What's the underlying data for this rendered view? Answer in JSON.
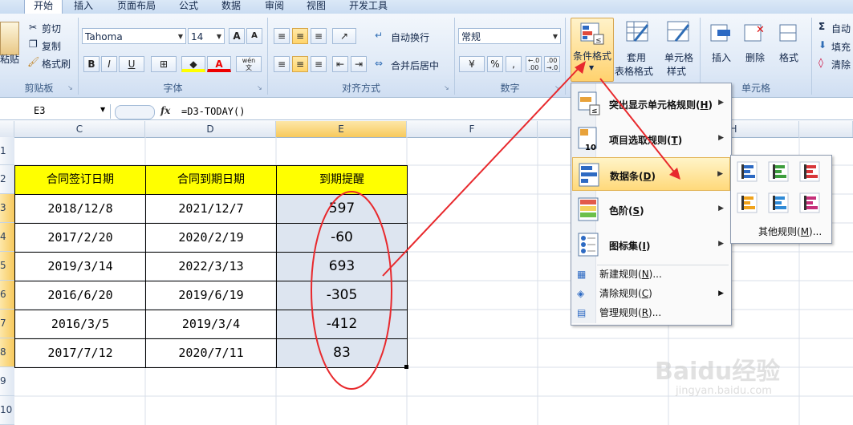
{
  "tabs": {
    "home": "开始",
    "insert": "插入",
    "layout": "页面布局",
    "formula": "公式",
    "data": "数据",
    "review": "审阅",
    "view": "视图",
    "dev": "开发工具"
  },
  "clipboard": {
    "paste": "粘贴",
    "cut": "剪切",
    "copy": "复制",
    "painter": "格式刷",
    "label": "剪贴板"
  },
  "font": {
    "name": "Tahoma",
    "size": "14",
    "label": "字体",
    "grow": "A",
    "shrink": "A",
    "bold": "B",
    "italic": "I",
    "underline": "U",
    "wen": "wén",
    "wen2": "文"
  },
  "align": {
    "wrap": "自动换行",
    "merge": "合并后居中",
    "label": "对齐方式"
  },
  "number": {
    "format": "常规",
    "percent": "%",
    "comma": ",",
    "inc": "+.0\n.00",
    "label": "数字"
  },
  "styles": {
    "cond": "条件格式",
    "table1": "套用",
    "table2": "表格格式",
    "cell1": "单元格",
    "cell2": "样式"
  },
  "cells": {
    "insert": "插入",
    "delete": "删除",
    "format": "格式",
    "label": "单元格"
  },
  "editing": {
    "autosum": "自动",
    "fill": "填充",
    "clear": "清除"
  },
  "formula_bar": {
    "name_box": "E3",
    "fx": "fx",
    "formula": "=D3-TODAY()"
  },
  "columns": [
    "C",
    "D",
    "E",
    "F",
    "G",
    "H"
  ],
  "rows": [
    "1",
    "2",
    "3",
    "4",
    "5",
    "6",
    "7",
    "8",
    "9",
    "10"
  ],
  "table": {
    "headers": [
      "合同签订日期",
      "合同到期日期",
      "到期提醒"
    ],
    "rows": [
      [
        "2018/12/8",
        "2021/12/7",
        "597"
      ],
      [
        "2017/2/20",
        "2020/2/19",
        "-60"
      ],
      [
        "2019/3/14",
        "2022/3/13",
        "693"
      ],
      [
        "2016/6/20",
        "2019/6/19",
        "-305"
      ],
      [
        "2016/3/5",
        "2019/3/4",
        "-412"
      ],
      [
        "2017/7/12",
        "2020/7/11",
        "83"
      ]
    ]
  },
  "menu": {
    "highlight_pre": "突出显示单元格规则(",
    "highlight_key": "H",
    "highlight_post": ")",
    "top_pre": "项目选取规则(",
    "top_key": "T",
    "top_post": ")",
    "databar_pre": "数据条(",
    "databar_key": "D",
    "databar_post": ")",
    "scale_pre": "色阶(",
    "scale_key": "S",
    "scale_post": ")",
    "iconset_pre": "图标集(",
    "iconset_key": "I",
    "iconset_post": ")",
    "new_pre": "新建规则(",
    "new_key": "N",
    "new_post": ")...",
    "clear_pre": "清除规则(",
    "clear_key": "C",
    "clear_post": ")",
    "manage_pre": "管理规则(",
    "manage_key": "R",
    "manage_post": ")..."
  },
  "submenu": {
    "more_pre": "其他规则(",
    "more_key": "M",
    "more_post": ")..."
  },
  "watermark": {
    "brand": "Baidu经验",
    "url": "jingyan.baidu.com"
  },
  "colors": {
    "header_fill": "#ffff00",
    "selected_fill": "#dde5f0",
    "annotation": "#e8292d",
    "accent": "#f7c95c"
  }
}
